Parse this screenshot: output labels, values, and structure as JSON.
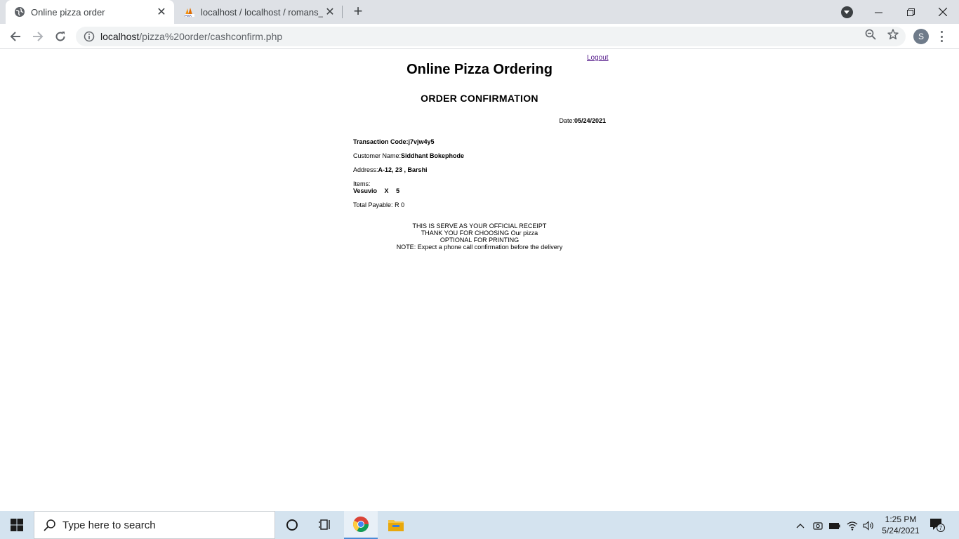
{
  "browser": {
    "tabs": [
      {
        "title": "Online pizza order",
        "active": true
      },
      {
        "title": "localhost / localhost / romans_db",
        "active": false
      }
    ],
    "url_host": "localhost",
    "url_path": "/pizza%20order/cashconfirm.php",
    "profile_initial": "S"
  },
  "page": {
    "logout_label": "Logout",
    "site_title": "Online Pizza Ordering",
    "confirmation_title": "ORDER CONFIRMATION",
    "date_label": "Date:",
    "date_value": "05/24/2021",
    "transaction_label": "Transaction Code:",
    "transaction_value": "j7vjw4y5",
    "customer_label": "Customer Name:",
    "customer_value": "Siddhant Bokephode",
    "address_label": "Address:",
    "address_value": "A-12, 23 , Barshi",
    "items_label": "Items:",
    "items": [
      {
        "name": "Vesuvio",
        "x": "X",
        "qty": "5"
      }
    ],
    "total_label": "Total Payable:",
    "total_value": "R 0",
    "receipt_lines": [
      "THIS IS SERVE AS YOUR OFFICIAL RECEIPT",
      "THANK YOU FOR CHOOSING Our pizza",
      "OPTIONAL FOR PRINTING",
      "NOTE: Expect a phone call confirmation before the delivery"
    ]
  },
  "taskbar": {
    "search_placeholder": "Type here to search",
    "time": "1:25 PM",
    "date": "5/24/2021",
    "notification_count": "7"
  },
  "colors": {
    "tabbar_bg": "#dee1e6",
    "taskbar_bg": "#d4e3ef",
    "link_visited": "#551a8b"
  }
}
